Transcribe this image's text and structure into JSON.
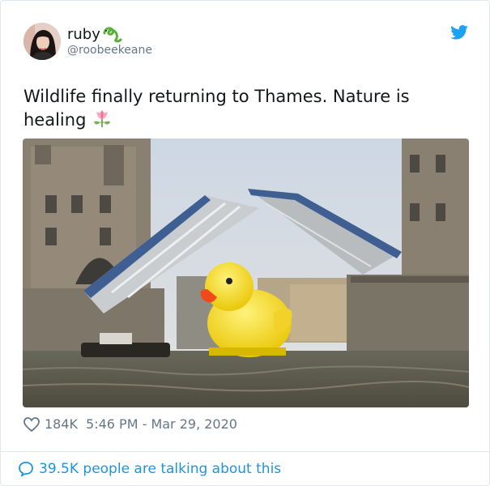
{
  "user": {
    "display_name": "ruby",
    "handle": "@roobeekeane",
    "avatar_icon": "avatar-photo",
    "name_emoji_icon": "lizard-emoji-icon"
  },
  "tweet": {
    "text": "Wildlife finally returning to Thames. Nature is healing",
    "text_emoji_icon": "tulip-emoji-icon",
    "image_icon": "rubber-duck-tower-bridge-photo"
  },
  "meta": {
    "likes": "184K",
    "timestamp": "5:46 PM - Mar 29, 2020"
  },
  "footer": {
    "talking_text": "39.5K people are talking about this"
  },
  "colors": {
    "twitter_blue": "#1da1f2",
    "link_blue": "#1b95e0",
    "secondary_text": "#657786",
    "primary_text": "#14171a"
  }
}
